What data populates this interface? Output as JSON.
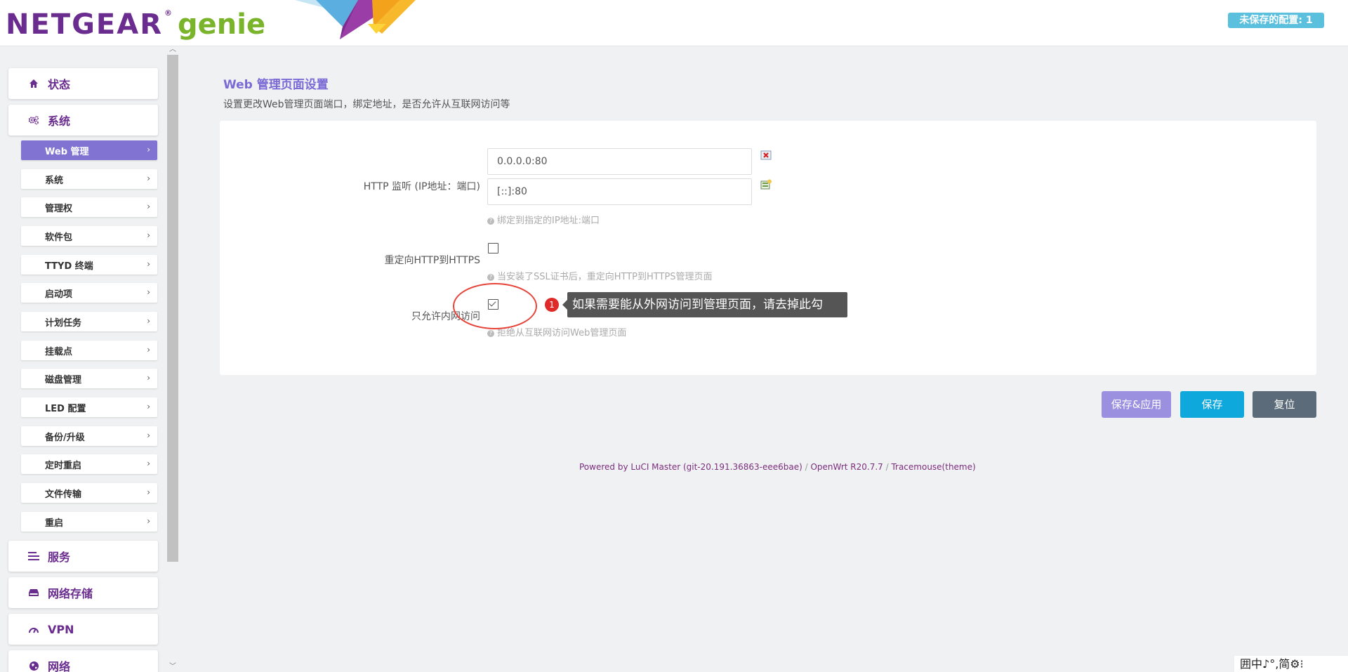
{
  "header": {
    "logo_brand": "NETGEAR",
    "logo_reg": "®",
    "logo_product": "genie",
    "unsaved_badge": "未保存的配置: 1"
  },
  "sidebar": {
    "main": [
      {
        "label": "状态",
        "icon": "home-icon"
      },
      {
        "label": "系统",
        "icon": "gears-icon"
      },
      {
        "label": "服务",
        "icon": "list-icon"
      },
      {
        "label": "网络存储",
        "icon": "drive-icon"
      },
      {
        "label": "VPN",
        "icon": "gauge-icon"
      },
      {
        "label": "网络",
        "icon": "globe-icon"
      }
    ],
    "sub": [
      {
        "label": "Web 管理"
      },
      {
        "label": "系统"
      },
      {
        "label": "管理权"
      },
      {
        "label": "软件包"
      },
      {
        "label": "TTYD 终端"
      },
      {
        "label": "启动项"
      },
      {
        "label": "计划任务"
      },
      {
        "label": "挂载点"
      },
      {
        "label": "磁盘管理"
      },
      {
        "label": "LED 配置"
      },
      {
        "label": "备份/升级"
      },
      {
        "label": "定时重启"
      },
      {
        "label": "文件传输"
      },
      {
        "label": "重启"
      }
    ],
    "chevron": "›"
  },
  "page": {
    "title": "Web 管理页面设置",
    "description": "设置更改Web管理页面端口，绑定地址，是否允许从互联网访问等"
  },
  "form": {
    "http_label": "HTTP 监听 (IP地址：端口)",
    "http_values": [
      "0.0.0.0:80",
      "[::]:80"
    ],
    "http_hint": "绑定到指定的IP地址:端口",
    "redirect_label": "重定向HTTP到HTTPS",
    "redirect_checked": false,
    "redirect_hint": "当安装了SSL证书后，重定向HTTP到HTTPS管理页面",
    "lan_only_label": "只允许内网访问",
    "lan_only_checked": true,
    "lan_only_hint": "拒绝从互联网访问Web管理页面"
  },
  "annotation": {
    "badge": "1",
    "tooltip": "如果需要能从外网访问到管理页面，请去掉此勾"
  },
  "buttons": {
    "save_apply": "保存&应用",
    "save": "保存",
    "reset": "复位"
  },
  "footer": {
    "luci": "Powered by LuCI Master (git-20.191.36863-eee6bae)",
    "sep": " / ",
    "openwrt": "OpenWrt R20.7.7",
    "theme": "Tracemouse(theme)"
  },
  "ime": {
    "text": "囲中♪°,简⚙⁝"
  },
  "colors": {
    "brand_purple": "#6a2c8f",
    "genie_green": "#7ab42b",
    "active_menu": "#8073d2",
    "unsaved_badge": "#5bc0de",
    "save_button": "#0fa8dd",
    "apply_button": "#9b8fe0",
    "reset_button": "#5b6b79",
    "annotation_red": "#e8443a"
  }
}
